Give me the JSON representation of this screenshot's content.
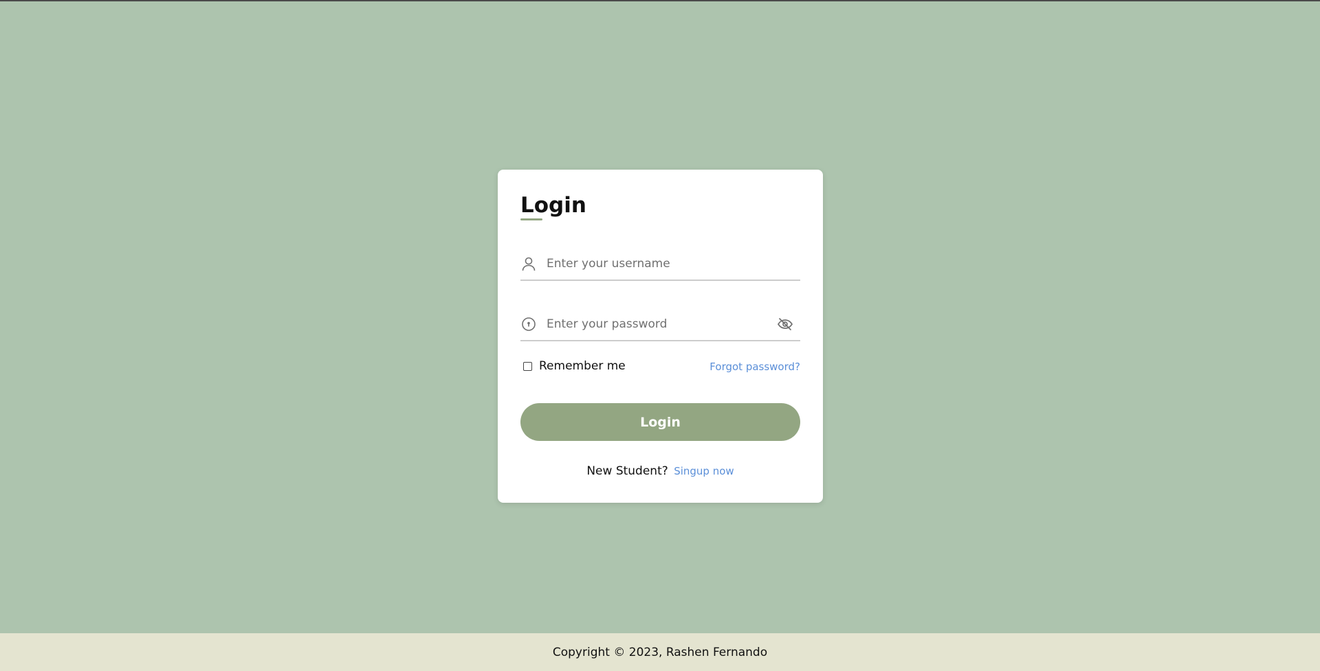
{
  "colors": {
    "page_background": "#adc4ae",
    "card_background": "#ffffff",
    "accent": "#93a682",
    "link": "#5b8fd8",
    "footer_background": "#e4e4d0"
  },
  "login_card": {
    "title": "Login",
    "username": {
      "icon": "user-icon",
      "placeholder": "Enter your username",
      "value": ""
    },
    "password": {
      "icon": "lock-icon",
      "placeholder": "Enter your password",
      "value": "",
      "toggle_icon": "eye-off-icon"
    },
    "remember_me": {
      "label": "Remember me",
      "checked": false
    },
    "forgot_password_link": "Forgot password?",
    "submit_label": "Login",
    "signup_prompt": "New Student?",
    "signup_link": "Singup now"
  },
  "footer": {
    "text": "Copyright © 2023, Rashen Fernando"
  }
}
